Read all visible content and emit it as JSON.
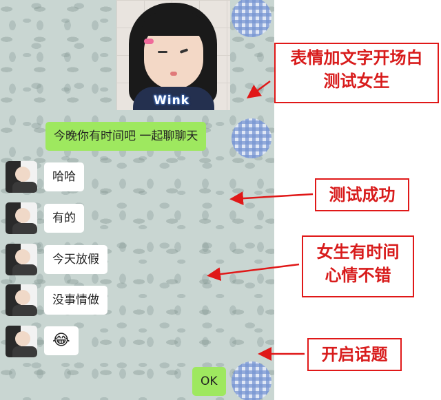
{
  "image_caption": "Wink",
  "messages": {
    "sent_1": "今晚你有时间吧 一起聊聊天",
    "recv_1": "哈哈",
    "recv_2": "有的",
    "recv_3": "今天放假",
    "recv_4": "没事情做",
    "recv_5_emoji": "😂",
    "sent_2": "OK"
  },
  "annotations": {
    "label_1_line1": "表情加文字开场白",
    "label_1_line2": "测试女生",
    "label_2": "测试成功",
    "label_3_line1": "女生有时间",
    "label_3_line2": "心情不错",
    "label_4": "开启话题"
  },
  "colors": {
    "sent_bubble": "#9ee85f",
    "received_bubble": "#ffffff",
    "annotation_red": "#d81b1b"
  }
}
